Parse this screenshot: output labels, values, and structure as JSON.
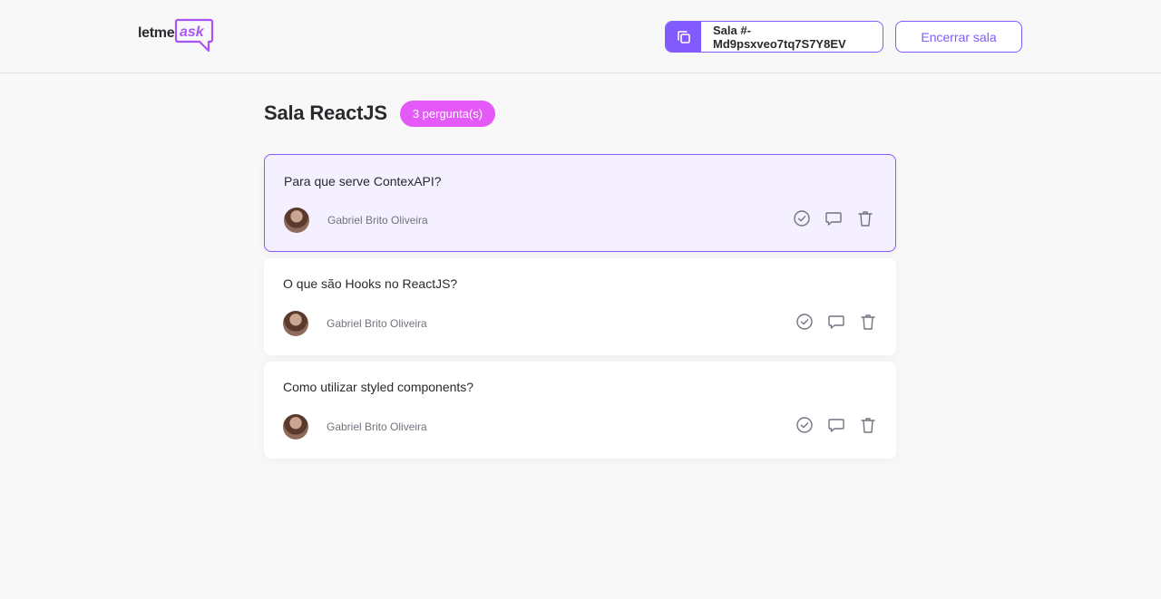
{
  "brand": {
    "logo_primary": "letme",
    "logo_accent": "ask",
    "accent_color": "#835afd",
    "badge_color": "#e559f9"
  },
  "header": {
    "room_code_label": "Sala #-Md9psxveo7tq7S7Y8EV",
    "copy_icon": "copy-icon",
    "end_room_label": "Encerrar sala"
  },
  "room": {
    "title": "Sala ReactJS",
    "question_count_label": "3 pergunta(s)"
  },
  "questions": [
    {
      "text": "Para que serve ContexAPI?",
      "author": "Gabriel Brito Oliveira",
      "highlighted": true
    },
    {
      "text": "O que são Hooks no ReactJS?",
      "author": "Gabriel Brito Oliveira",
      "highlighted": false
    },
    {
      "text": "Como utilizar styled components?",
      "author": "Gabriel Brito Oliveira",
      "highlighted": false
    }
  ],
  "action_icons": [
    "check-circle-icon",
    "answer-bubble-icon",
    "trash-icon"
  ]
}
